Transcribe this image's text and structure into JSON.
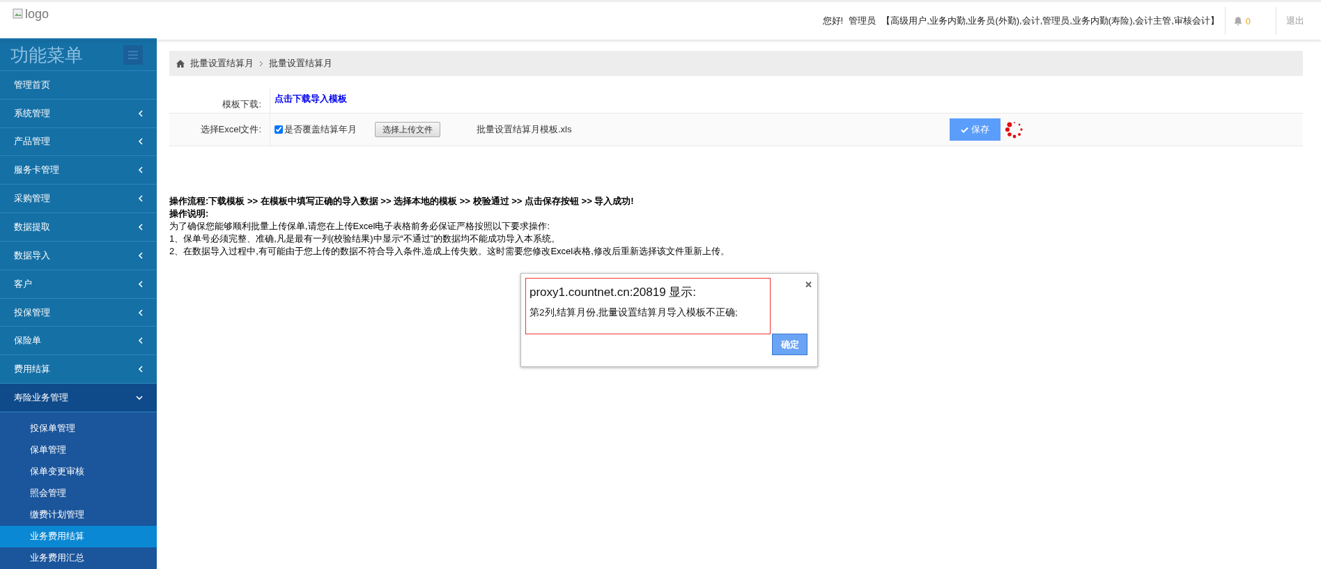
{
  "header": {
    "logo_alt": "logo",
    "greeting": "您好!",
    "user": "管理员",
    "roles": "【高级用户,业务内勤,业务员(外勤),会计,管理员,业务内勤(寿险),会计主管,审核会计】",
    "notifications": "0",
    "logout": "退出"
  },
  "sidebar": {
    "title": "功能菜单",
    "items": [
      {
        "kind": "link",
        "label": "管理首页"
      },
      {
        "kind": "menu",
        "label": "系统管理",
        "expanded": false
      },
      {
        "kind": "menu",
        "label": "产品管理",
        "expanded": false
      },
      {
        "kind": "menu",
        "label": "服务卡管理",
        "expanded": false
      },
      {
        "kind": "menu",
        "label": "采购管理",
        "expanded": false
      },
      {
        "kind": "menu",
        "label": "数据提取",
        "expanded": false
      },
      {
        "kind": "menu",
        "label": "数据导入",
        "expanded": false
      },
      {
        "kind": "menu",
        "label": "客户",
        "expanded": false
      },
      {
        "kind": "menu",
        "label": "投保管理",
        "expanded": false
      },
      {
        "kind": "menu",
        "label": "保险单",
        "expanded": false
      },
      {
        "kind": "menu",
        "label": "费用结算",
        "expanded": false
      },
      {
        "kind": "menu",
        "label": "寿险业务管理",
        "expanded": true,
        "children": [
          {
            "label": "投保单管理",
            "selected": false
          },
          {
            "label": "保单管理",
            "selected": false
          },
          {
            "label": "保单变更审核",
            "selected": false
          },
          {
            "label": "照会管理",
            "selected": false
          },
          {
            "label": "缴费计划管理",
            "selected": false
          },
          {
            "label": "业务费用结算",
            "selected": true
          },
          {
            "label": "业务费用汇总",
            "selected": false
          }
        ]
      }
    ]
  },
  "breadcrumb": [
    "批量设置结算月",
    "批量设置结算月"
  ],
  "form": {
    "template_label": "模板下载:",
    "template_link": "点击下载导入模板",
    "file_label": "选择Excel文件:",
    "overwrite": {
      "label": "是否覆盖结算年月",
      "checked": true
    },
    "upload_button": "选择上传文件",
    "file_name": "批量设置结算月模板.xls",
    "save_button": "保存"
  },
  "instructions": {
    "flow": "操作流程:下载模板 >> 在模板中填写正确的导入数据 >> 选择本地的模板 >> 校验通过 >> 点击保存按钮 >> 导入成功!",
    "heading": "操作说明:",
    "lines": [
      "为了确保您能够顺利批量上传保单,请您在上传Excel电子表格前务必保证严格按照以下要求操作:",
      "1、保单号必须完整、准确,凡是最有一列(校验结果)中显示“不通过”的数据均不能成功导入本系统。",
      "2、在数据导入过程中,有可能由于您上传的数据不符合导入条件,造成上传失败。这时需要您修改Excel表格,修改后重新选择该文件重新上传。"
    ]
  },
  "dialog": {
    "title": "proxy1.countnet.cn:20819 显示:",
    "message": "第2列,结算月份,批量设置结算月导入模板不正确;",
    "ok_button": "确定"
  }
}
